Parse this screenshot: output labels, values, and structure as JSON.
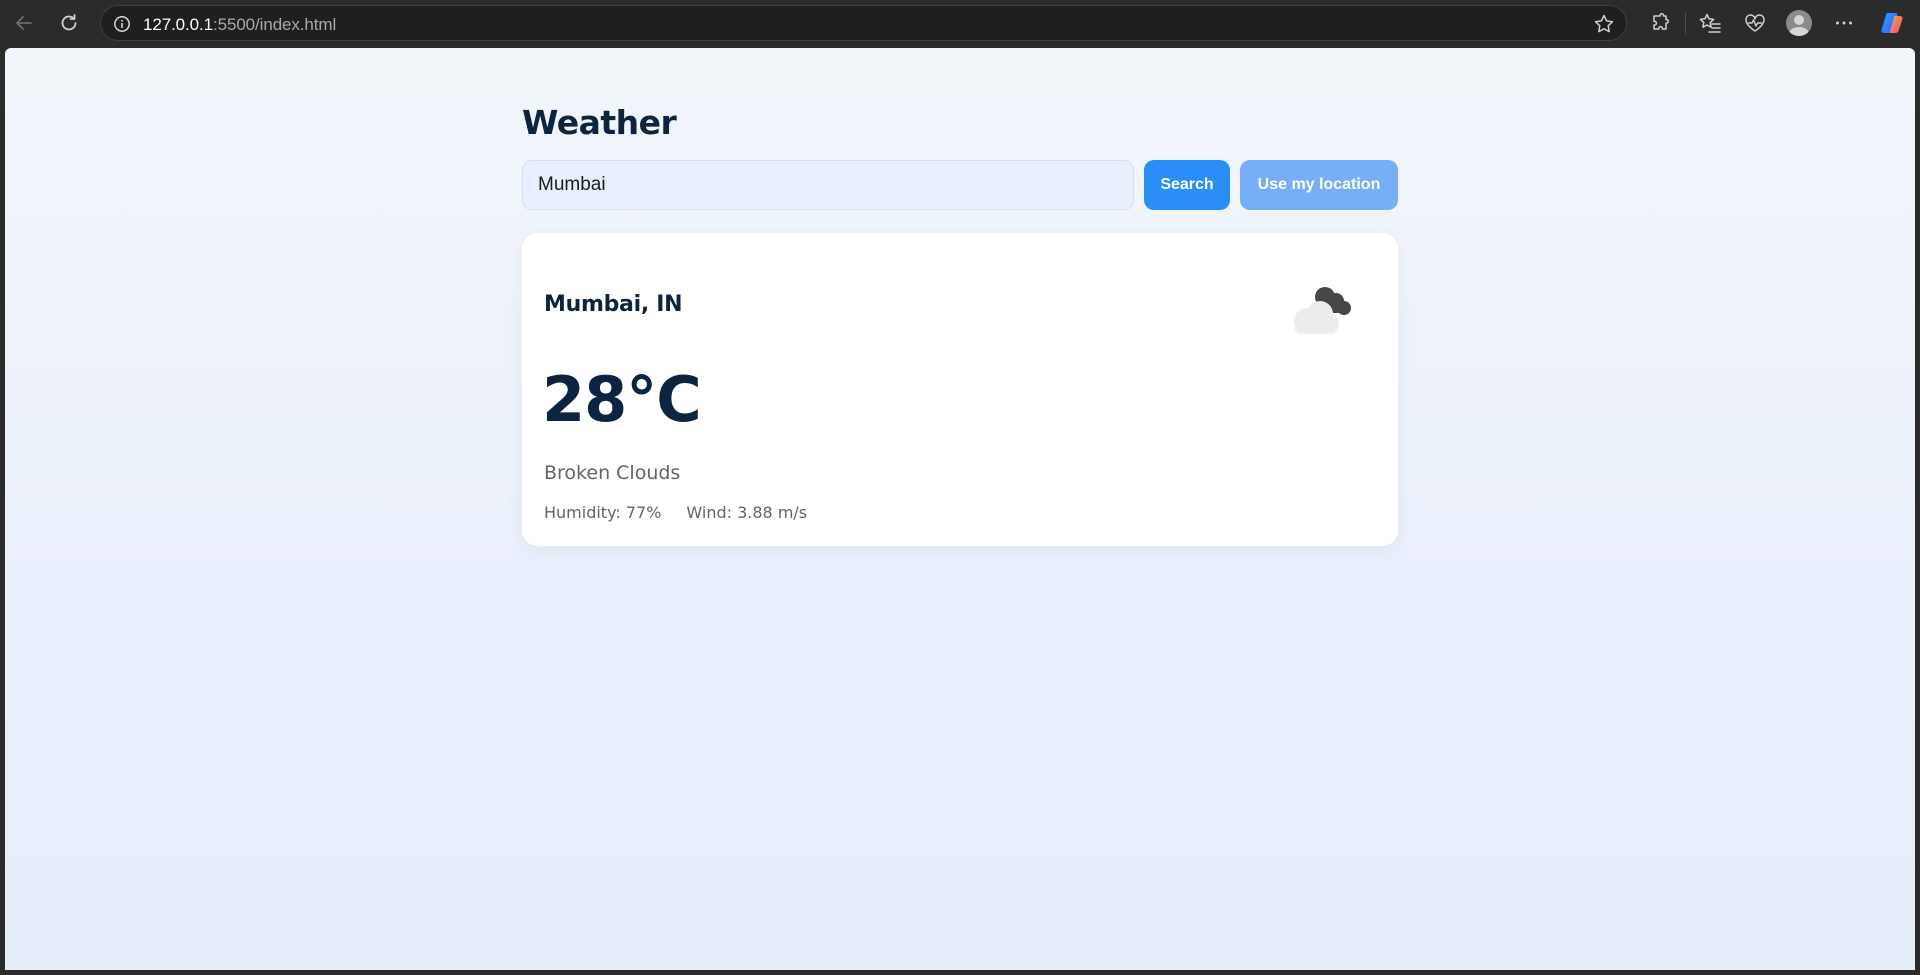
{
  "browser": {
    "url_host": "127.0.0.1",
    "url_path": ":5500/index.html",
    "icons": [
      "back-icon",
      "reload-icon",
      "site-info-icon",
      "star-icon",
      "extensions-icon",
      "favorites-icon",
      "browser-essentials-icon",
      "profile-icon",
      "more-icon",
      "copilot-icon"
    ]
  },
  "app": {
    "title": "Weather",
    "search": {
      "value": "Mumbai",
      "search_label": "Search",
      "location_label": "Use my location"
    },
    "card": {
      "city": "Mumbai, IN",
      "temperature": "28°C",
      "description": "Broken Clouds",
      "humidity": "Humidity: 77%",
      "wind": "Wind: 3.88 m/s",
      "icon": "broken-clouds-icon"
    },
    "colors": {
      "primary": "#2a8ef6",
      "secondary_button": "#78aef7",
      "heading": "#0d2440",
      "input_bg": "#e8f0fd"
    }
  }
}
